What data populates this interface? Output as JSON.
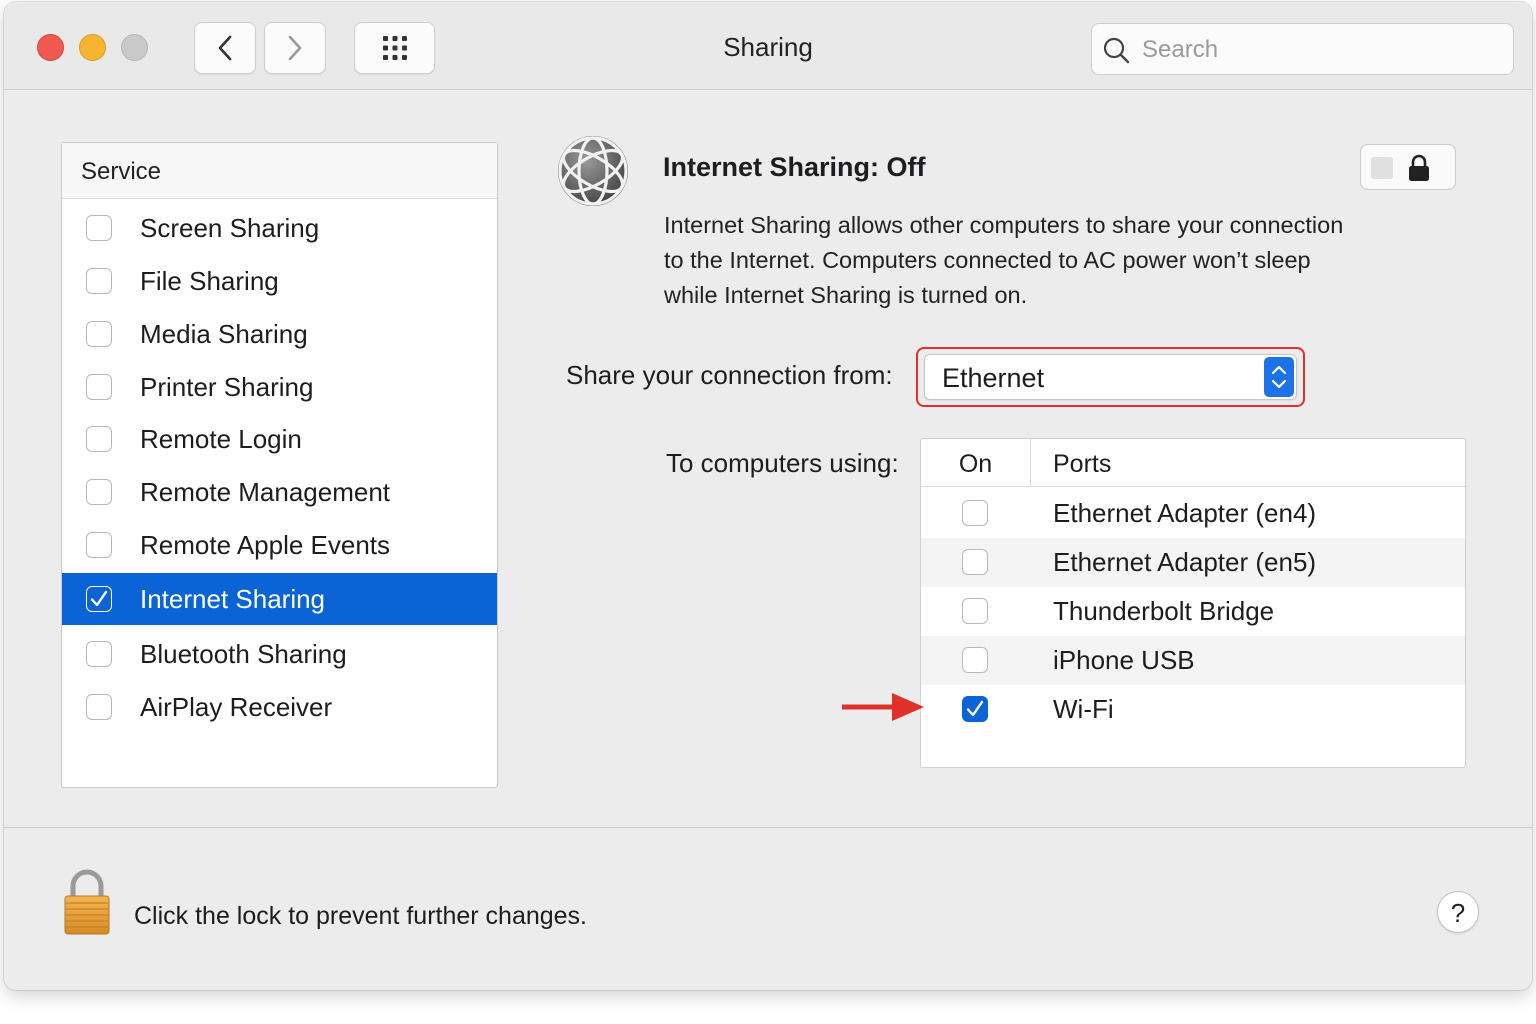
{
  "window": {
    "title": "Sharing",
    "search_placeholder": "Search"
  },
  "toolbar": {
    "back_icon": "chevron-left-icon",
    "forward_icon": "chevron-right-icon",
    "grid_icon": "grid-icon"
  },
  "services": {
    "header": "Service",
    "items": [
      {
        "label": "Screen Sharing",
        "checked": false,
        "selected": false
      },
      {
        "label": "File Sharing",
        "checked": false,
        "selected": false
      },
      {
        "label": "Media Sharing",
        "checked": false,
        "selected": false
      },
      {
        "label": "Printer Sharing",
        "checked": false,
        "selected": false
      },
      {
        "label": "Remote Login",
        "checked": false,
        "selected": false
      },
      {
        "label": "Remote Management",
        "checked": false,
        "selected": false
      },
      {
        "label": "Remote Apple Events",
        "checked": false,
        "selected": false
      },
      {
        "label": "Internet Sharing",
        "checked": true,
        "selected": true
      },
      {
        "label": "Bluetooth Sharing",
        "checked": false,
        "selected": false
      },
      {
        "label": "AirPlay Receiver",
        "checked": false,
        "selected": false
      }
    ]
  },
  "detail": {
    "status_title": "Internet Sharing: Off",
    "description_lines": [
      "Internet Sharing allows other computers to share your connection",
      "to the Internet. Computers connected to AC power won’t sleep",
      "while Internet Sharing is turned on."
    ],
    "share_from_label": "Share your connection from:",
    "share_from_value": "Ethernet",
    "to_computers_label": "To computers using:",
    "ports_columns": {
      "on": "On",
      "ports": "Ports"
    },
    "ports": [
      {
        "label": "Ethernet Adapter (en4)",
        "on": false
      },
      {
        "label": "Ethernet Adapter (en5)",
        "on": false
      },
      {
        "label": "Thunderbolt Bridge",
        "on": false
      },
      {
        "label": "iPhone USB",
        "on": false
      },
      {
        "label": "Wi-Fi",
        "on": true
      }
    ]
  },
  "footer": {
    "lock_text": "Click the lock to prevent further changes.",
    "help_label": "?"
  },
  "colors": {
    "selection_blue": "#0a64d6",
    "highlight_red": "#e0302a",
    "lock_orange": "#e8a23c"
  }
}
